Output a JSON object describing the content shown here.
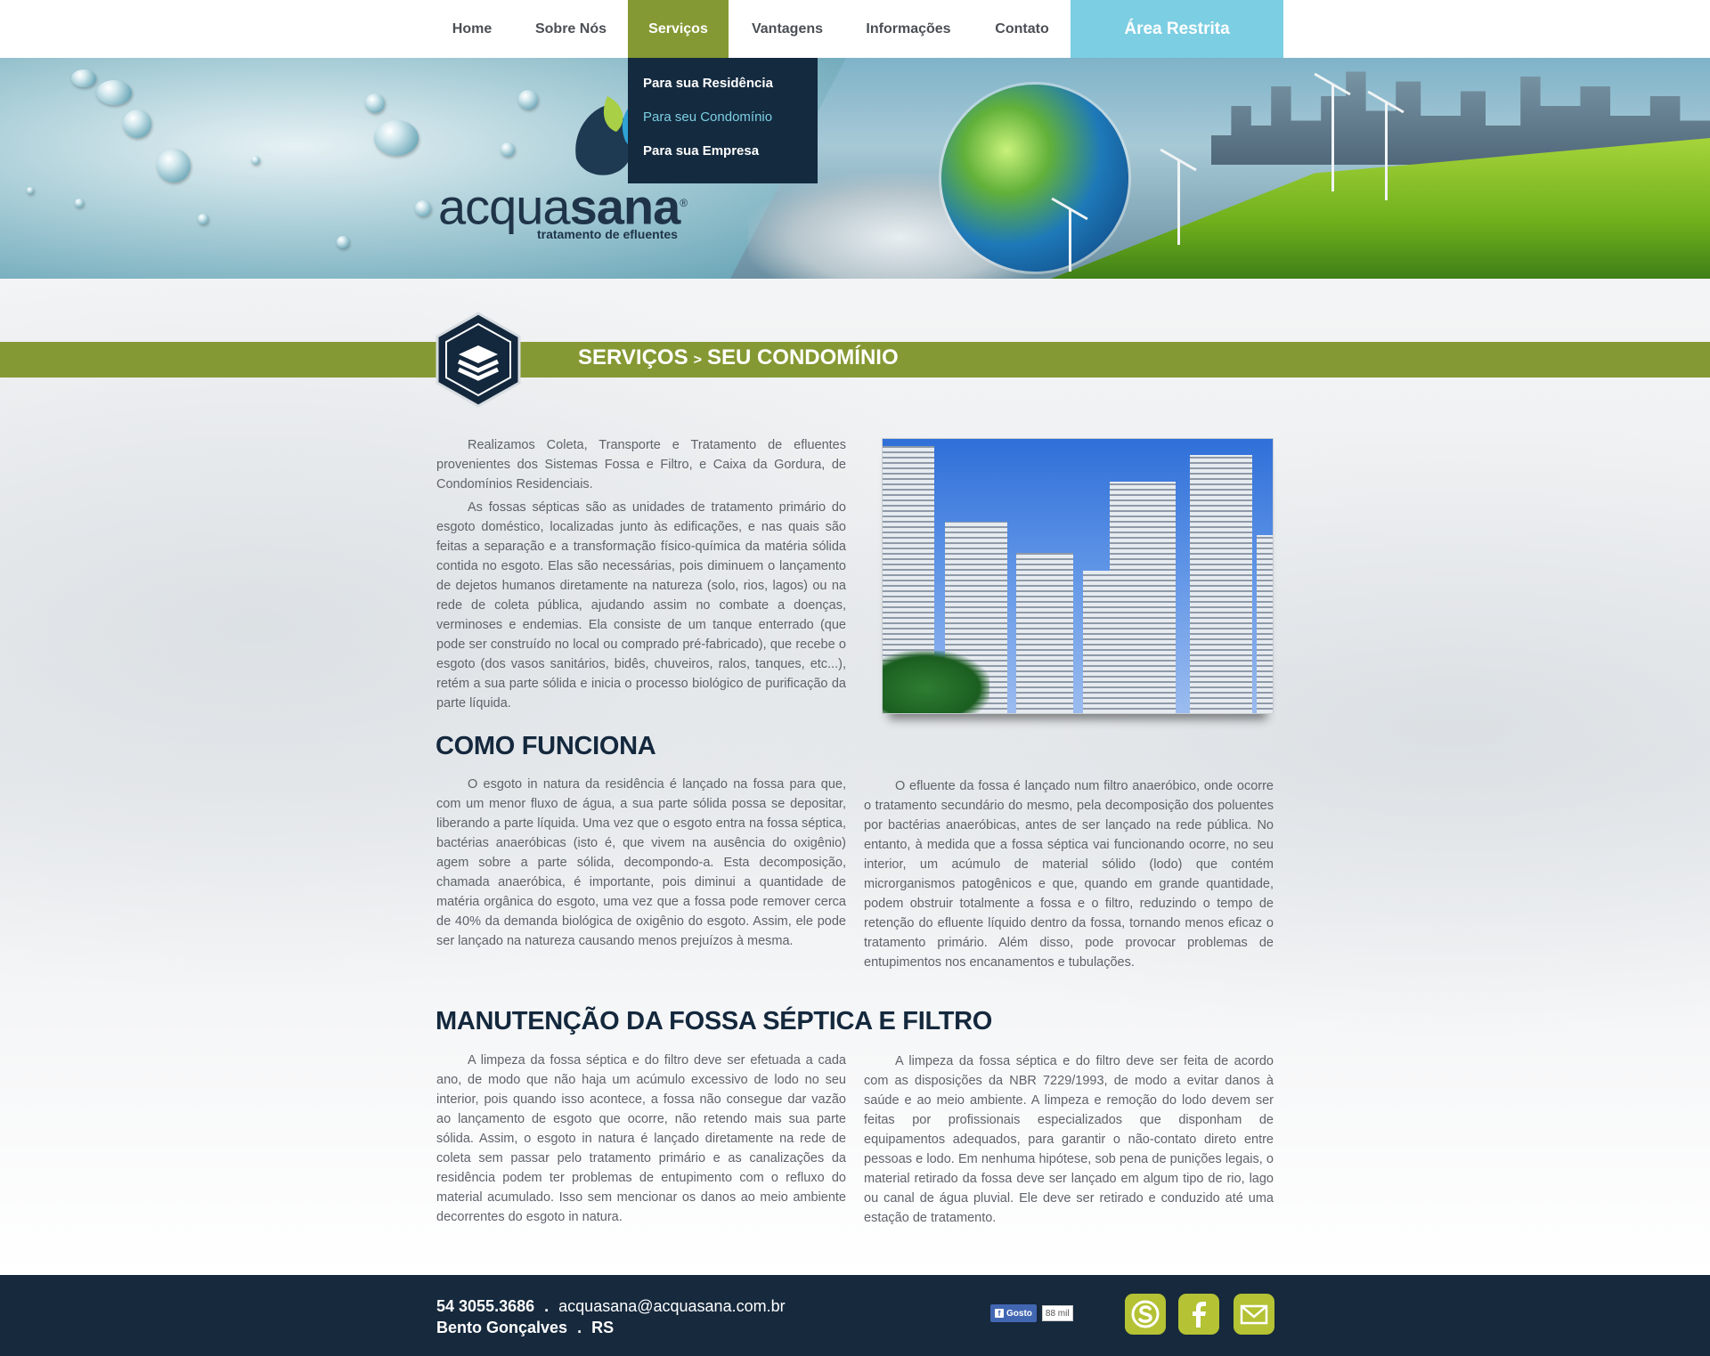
{
  "nav": {
    "items": [
      {
        "label": "Home"
      },
      {
        "label": "Sobre Nós"
      },
      {
        "label": "Serviços"
      },
      {
        "label": "Vantagens"
      },
      {
        "label": "Informações"
      },
      {
        "label": "Contato"
      }
    ],
    "active": "Serviços",
    "area_restrita": "Área Restrita"
  },
  "dropdown": {
    "items": [
      {
        "label": "Para sua Residência"
      },
      {
        "label": "Para seu Condomínio"
      },
      {
        "label": "Para sua Empresa"
      }
    ]
  },
  "logo": {
    "word_a": "acqua",
    "word_b": "sana",
    "registered": "®",
    "subtitle": "tratamento de efluentes"
  },
  "page_title": {
    "section": "SERVIÇOS",
    "separator": ">",
    "subsection": "SEU CONDOMÍNIO",
    "icon": "layers-icon"
  },
  "intro": {
    "p1": "Realizamos Coleta, Transporte e Tratamento de efluentes provenientes dos Sistemas Fossa e Filtro, e Caixa da Gordura, de Condomínios Residenciais.",
    "p2": "As fossas sépticas são as unidades de tratamento primário do esgoto doméstico, localizadas junto às edificações, e nas quais são feitas a separação e a transformação físico-química da matéria sólida contida no esgoto. Elas são necessárias, pois diminuem o lançamento de dejetos humanos diretamente na natureza (solo, rios, lagos) ou na rede de coleta pública, ajudando assim no combate a doenças, verminoses e endemias. Ela consiste de um tanque enterrado (que pode ser construído no local ou comprado pré-fabricado), que recebe o esgoto (dos vasos sanitários, bidês, chuveiros, ralos, tanques, etc...), retém a sua parte sólida e inicia o processo biológico de purificação da parte líquida."
  },
  "como_funciona": {
    "heading": "COMO FUNCIONA",
    "left": "O esgoto in natura da residência é lançado na fossa para que, com um menor fluxo de água, a sua parte sólida possa se depositar, liberando a parte líquida. Uma vez que o esgoto entra na fossa séptica, bactérias anaeróbicas (isto é, que vivem na ausência do oxigênio) agem sobre a parte sólida, decompondo-a. Esta decomposição, chamada anaeróbica, é importante, pois diminui a quantidade de matéria orgânica do esgoto, uma vez que a fossa pode remover cerca de 40% da demanda biológica de oxigênio do esgoto. Assim, ele pode ser lançado na natureza causando menos prejuízos à mesma.",
    "right": "O efluente da fossa é lançado num filtro anaeróbico, onde ocorre o tratamento secundário do mesmo, pela decomposição dos poluentes por bactérias anaeróbicas, antes de ser lançado na rede pública. No entanto, à medida que a fossa séptica vai funcionando ocorre, no seu interior, um acúmulo de material sólido (lodo) que contém microrganismos patogênicos e que, quando em grande quantidade, podem obstruir totalmente a fossa e o filtro, reduzindo o tempo de retenção do efluente líquido dentro da fossa, tornando menos eficaz o tratamento primário. Além disso, pode provocar problemas de entupimentos nos encanamentos e tubulações."
  },
  "manutencao": {
    "heading": "MANUTENÇÃO DA FOSSA SÉPTICA E FILTRO",
    "left": "A limpeza da fossa séptica e do filtro deve ser efetuada a cada ano, de modo que não haja um acúmulo excessivo de lodo no seu interior, pois quando isso acontece, a fossa não consegue dar vazão ao lançamento de esgoto que ocorre, não retendo mais sua parte sólida. Assim, o esgoto in natura é lançado diretamente na rede de coleta sem passar pelo tratamento primário e as canalizações da residência podem ter problemas de entupimento com o refluxo do material acumulado. Isso sem mencionar os danos ao meio ambiente decorrentes do esgoto in natura.",
    "right": "A limpeza da fossa séptica e do filtro deve ser feita de acordo com as disposições da NBR 7229/1993, de modo a evitar danos à saúde e ao meio ambiente. A limpeza e remoção do lodo devem ser feitas por profissionais especializados que disponham de equipamentos adequados, para garantir o não-contato direto entre pessoas e lodo. Em nenhuma hipótese, sob pena de punições legais, o material retirado da fossa deve ser lançado em algum tipo de rio, lago ou canal de água pluvial. Ele deve ser retirado e conduzido até uma estação de tratamento."
  },
  "footer": {
    "phone": "54 3055.3686",
    "dot": ".",
    "email": "acquasana@acquasana.com.br",
    "city": "Bento Gonçalves",
    "state": "RS",
    "fb_like": "Gosto",
    "fb_count": "88 mil",
    "social": [
      "skype-icon",
      "facebook-icon",
      "email-icon"
    ]
  },
  "colors": {
    "accent_green": "#849933",
    "navy": "#16293d",
    "restrita_blue": "#7ccee2",
    "social_green": "#b4c234"
  }
}
